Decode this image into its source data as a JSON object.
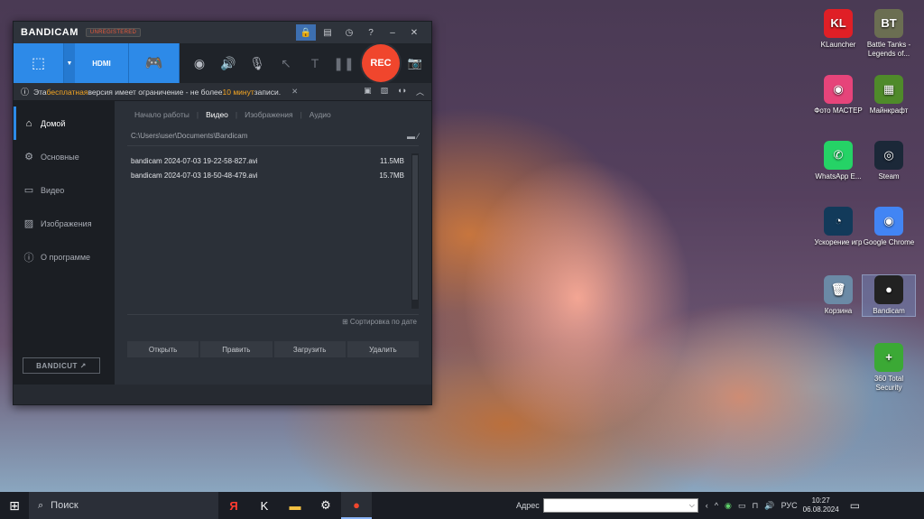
{
  "desktop": {
    "icons": [
      {
        "label": "KLauncher",
        "glyph": "KL",
        "color": "#e01f26",
        "icon": "klauncher-icon"
      },
      {
        "label": "Battle Tanks - Legends of...",
        "glyph": "BT",
        "color": "#6b6e52",
        "icon": "battle-tanks-icon"
      },
      {
        "label": "Фото МАСТЕР",
        "glyph": "◉",
        "color": "#e6447a",
        "icon": "photo-master-icon"
      },
      {
        "label": "Майнкрафт",
        "glyph": "▦",
        "color": "#4f8a2a",
        "icon": "minecraft-icon"
      },
      {
        "label": "WhatsApp E...",
        "glyph": "✆",
        "color": "#25d366",
        "icon": "whatsapp-icon"
      },
      {
        "label": "Steam",
        "glyph": "◎",
        "color": "#1b2838",
        "icon": "steam-icon"
      },
      {
        "label": "Ускорение игр",
        "glyph": "◔",
        "color": "#123a5a",
        "icon": "game-booster-icon"
      },
      {
        "label": "Google Chrome",
        "glyph": "◉",
        "color": "#4285f4",
        "icon": "chrome-icon"
      },
      {
        "label": "Корзина",
        "glyph": "🗑",
        "color": "#6b8aa6",
        "icon": "recycle-bin-icon"
      },
      {
        "label": "Bandicam",
        "glyph": "●",
        "color": "#222",
        "icon": "bandicam-icon"
      },
      {
        "label": "360 Total Security",
        "glyph": "+",
        "color": "#3ba935",
        "icon": "total-security-icon"
      }
    ]
  },
  "bandicam": {
    "logo": "BANDICAM",
    "unregistered": "UNREGISTERED",
    "titlebar_icons": {
      "lock": "🔒",
      "folder": "▤",
      "clock": "◷",
      "help": "?",
      "min": "–",
      "close": "✕"
    },
    "toolbar": {
      "screen_mode": "⬚",
      "hdmi_label": "HDMI",
      "game_mode": "🎮",
      "webcam": "◉",
      "speaker": "🔊",
      "mic": "🎙",
      "cursor": "↖",
      "text": "T",
      "pause": "❚❚",
      "rec_label": "REC",
      "camera": "📷"
    },
    "notice": {
      "prefix": "Эта ",
      "free": "бесплатная",
      "middle": " версия имеет ограничение - не более ",
      "limit": "10 минут",
      "suffix": " записи.",
      "close": "✕"
    },
    "sidebar": {
      "items": [
        {
          "label": "Домой",
          "glyph": "⌂"
        },
        {
          "label": "Основные",
          "glyph": "⚙"
        },
        {
          "label": "Видео",
          "glyph": "▭"
        },
        {
          "label": "Изображения",
          "glyph": "▨"
        },
        {
          "label": "О программе",
          "glyph": "ⓘ"
        }
      ],
      "bandicut": "BANDICUT ↗"
    },
    "tabs": [
      "Начало работы",
      "Видео",
      "Изображения",
      "Аудио"
    ],
    "active_tab": "Видео",
    "path": "C:\\Users\\user\\Documents\\Bandicam",
    "files": [
      {
        "name": "bandicam 2024-07-03 19-22-58-827.avi",
        "size": "11.5MB"
      },
      {
        "name": "bandicam 2024-07-03 18-50-48-479.avi",
        "size": "15.7MB"
      }
    ],
    "sort_label": "⊞ Сортировка по дате",
    "actions": [
      "Открыть",
      "Править",
      "Загрузить",
      "Удалить"
    ]
  },
  "taskbar": {
    "search_placeholder": "Поиск",
    "address_label": "Адрес",
    "language": "РУС",
    "time": "10:27",
    "date": "06.08.2024"
  }
}
